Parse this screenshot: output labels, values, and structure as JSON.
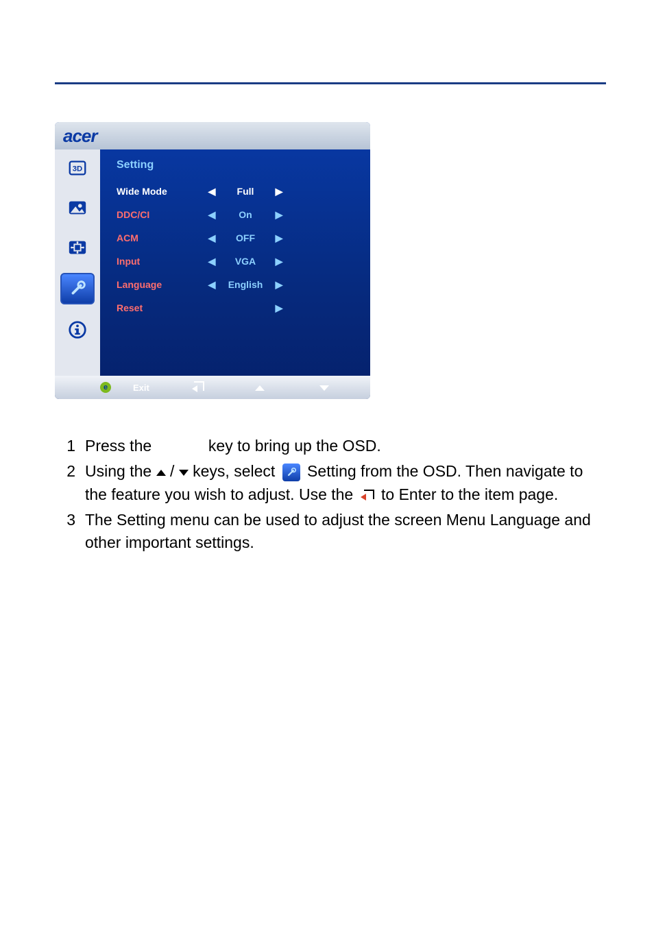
{
  "osd": {
    "brand": "acer",
    "title": "Setting",
    "rows": [
      {
        "label": "Wide Mode",
        "value": "Full",
        "hasLeft": true,
        "hasRight": true,
        "active": true
      },
      {
        "label": "DDC/CI",
        "value": "On",
        "hasLeft": true,
        "hasRight": true,
        "active": false
      },
      {
        "label": "ACM",
        "value": "OFF",
        "hasLeft": true,
        "hasRight": true,
        "active": false
      },
      {
        "label": "Input",
        "value": "VGA",
        "hasLeft": true,
        "hasRight": true,
        "active": false
      },
      {
        "label": "Language",
        "value": "English",
        "hasLeft": true,
        "hasRight": true,
        "active": false
      },
      {
        "label": "Reset",
        "value": "",
        "hasLeft": false,
        "hasRight": true,
        "active": false
      }
    ],
    "bottom": {
      "exit": "Exit",
      "eGlyph": "e"
    },
    "side_icons": [
      "3d-icon",
      "picture-icon",
      "position-icon",
      "setting-icon",
      "info-icon"
    ],
    "selected_side_index": 3
  },
  "instructions": {
    "items": [
      {
        "num": "1",
        "parts": [
          {
            "t": "Press the "
          },
          {
            "k": "menu-key-gap"
          },
          {
            "t": " key to bring up the OSD."
          }
        ]
      },
      {
        "num": "2",
        "parts": [
          {
            "t": "Using the "
          },
          {
            "k": "up-glyph"
          },
          {
            "t": " / "
          },
          {
            "k": "down-glyph"
          },
          {
            "t": " keys, select "
          },
          {
            "k": "setting-box"
          },
          {
            "t": " Setting from the OSD. Then navigate to the feature you wish to adjust. Use the "
          },
          {
            "k": "enter-glyph"
          },
          {
            "t": " to Enter to the item page."
          }
        ]
      },
      {
        "num": "3",
        "parts": [
          {
            "t": "The Setting menu can be used to adjust the screen Menu Language and other important settings."
          }
        ]
      }
    ]
  }
}
